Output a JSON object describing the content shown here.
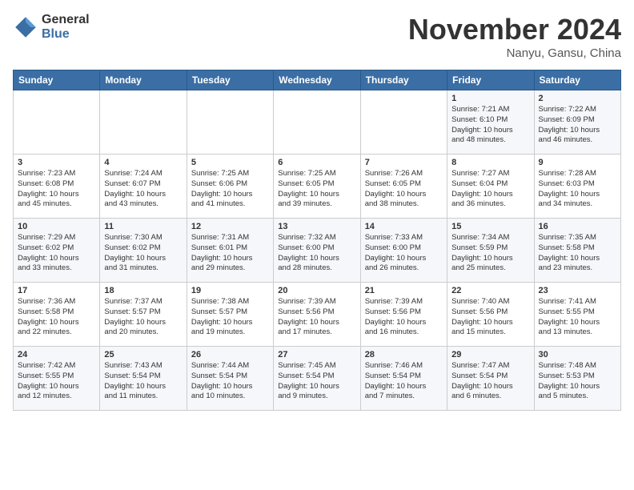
{
  "header": {
    "logo": {
      "general": "General",
      "blue": "Blue"
    },
    "title": "November 2024",
    "location": "Nanyu, Gansu, China"
  },
  "weekdays": [
    "Sunday",
    "Monday",
    "Tuesday",
    "Wednesday",
    "Thursday",
    "Friday",
    "Saturday"
  ],
  "weeks": [
    [
      {
        "day": "",
        "info": ""
      },
      {
        "day": "",
        "info": ""
      },
      {
        "day": "",
        "info": ""
      },
      {
        "day": "",
        "info": ""
      },
      {
        "day": "",
        "info": ""
      },
      {
        "day": "1",
        "info": "Sunrise: 7:21 AM\nSunset: 6:10 PM\nDaylight: 10 hours\nand 48 minutes."
      },
      {
        "day": "2",
        "info": "Sunrise: 7:22 AM\nSunset: 6:09 PM\nDaylight: 10 hours\nand 46 minutes."
      }
    ],
    [
      {
        "day": "3",
        "info": "Sunrise: 7:23 AM\nSunset: 6:08 PM\nDaylight: 10 hours\nand 45 minutes."
      },
      {
        "day": "4",
        "info": "Sunrise: 7:24 AM\nSunset: 6:07 PM\nDaylight: 10 hours\nand 43 minutes."
      },
      {
        "day": "5",
        "info": "Sunrise: 7:25 AM\nSunset: 6:06 PM\nDaylight: 10 hours\nand 41 minutes."
      },
      {
        "day": "6",
        "info": "Sunrise: 7:25 AM\nSunset: 6:05 PM\nDaylight: 10 hours\nand 39 minutes."
      },
      {
        "day": "7",
        "info": "Sunrise: 7:26 AM\nSunset: 6:05 PM\nDaylight: 10 hours\nand 38 minutes."
      },
      {
        "day": "8",
        "info": "Sunrise: 7:27 AM\nSunset: 6:04 PM\nDaylight: 10 hours\nand 36 minutes."
      },
      {
        "day": "9",
        "info": "Sunrise: 7:28 AM\nSunset: 6:03 PM\nDaylight: 10 hours\nand 34 minutes."
      }
    ],
    [
      {
        "day": "10",
        "info": "Sunrise: 7:29 AM\nSunset: 6:02 PM\nDaylight: 10 hours\nand 33 minutes."
      },
      {
        "day": "11",
        "info": "Sunrise: 7:30 AM\nSunset: 6:02 PM\nDaylight: 10 hours\nand 31 minutes."
      },
      {
        "day": "12",
        "info": "Sunrise: 7:31 AM\nSunset: 6:01 PM\nDaylight: 10 hours\nand 29 minutes."
      },
      {
        "day": "13",
        "info": "Sunrise: 7:32 AM\nSunset: 6:00 PM\nDaylight: 10 hours\nand 28 minutes."
      },
      {
        "day": "14",
        "info": "Sunrise: 7:33 AM\nSunset: 6:00 PM\nDaylight: 10 hours\nand 26 minutes."
      },
      {
        "day": "15",
        "info": "Sunrise: 7:34 AM\nSunset: 5:59 PM\nDaylight: 10 hours\nand 25 minutes."
      },
      {
        "day": "16",
        "info": "Sunrise: 7:35 AM\nSunset: 5:58 PM\nDaylight: 10 hours\nand 23 minutes."
      }
    ],
    [
      {
        "day": "17",
        "info": "Sunrise: 7:36 AM\nSunset: 5:58 PM\nDaylight: 10 hours\nand 22 minutes."
      },
      {
        "day": "18",
        "info": "Sunrise: 7:37 AM\nSunset: 5:57 PM\nDaylight: 10 hours\nand 20 minutes."
      },
      {
        "day": "19",
        "info": "Sunrise: 7:38 AM\nSunset: 5:57 PM\nDaylight: 10 hours\nand 19 minutes."
      },
      {
        "day": "20",
        "info": "Sunrise: 7:39 AM\nSunset: 5:56 PM\nDaylight: 10 hours\nand 17 minutes."
      },
      {
        "day": "21",
        "info": "Sunrise: 7:39 AM\nSunset: 5:56 PM\nDaylight: 10 hours\nand 16 minutes."
      },
      {
        "day": "22",
        "info": "Sunrise: 7:40 AM\nSunset: 5:56 PM\nDaylight: 10 hours\nand 15 minutes."
      },
      {
        "day": "23",
        "info": "Sunrise: 7:41 AM\nSunset: 5:55 PM\nDaylight: 10 hours\nand 13 minutes."
      }
    ],
    [
      {
        "day": "24",
        "info": "Sunrise: 7:42 AM\nSunset: 5:55 PM\nDaylight: 10 hours\nand 12 minutes."
      },
      {
        "day": "25",
        "info": "Sunrise: 7:43 AM\nSunset: 5:54 PM\nDaylight: 10 hours\nand 11 minutes."
      },
      {
        "day": "26",
        "info": "Sunrise: 7:44 AM\nSunset: 5:54 PM\nDaylight: 10 hours\nand 10 minutes."
      },
      {
        "day": "27",
        "info": "Sunrise: 7:45 AM\nSunset: 5:54 PM\nDaylight: 10 hours\nand 9 minutes."
      },
      {
        "day": "28",
        "info": "Sunrise: 7:46 AM\nSunset: 5:54 PM\nDaylight: 10 hours\nand 7 minutes."
      },
      {
        "day": "29",
        "info": "Sunrise: 7:47 AM\nSunset: 5:54 PM\nDaylight: 10 hours\nand 6 minutes."
      },
      {
        "day": "30",
        "info": "Sunrise: 7:48 AM\nSunset: 5:53 PM\nDaylight: 10 hours\nand 5 minutes."
      }
    ]
  ]
}
